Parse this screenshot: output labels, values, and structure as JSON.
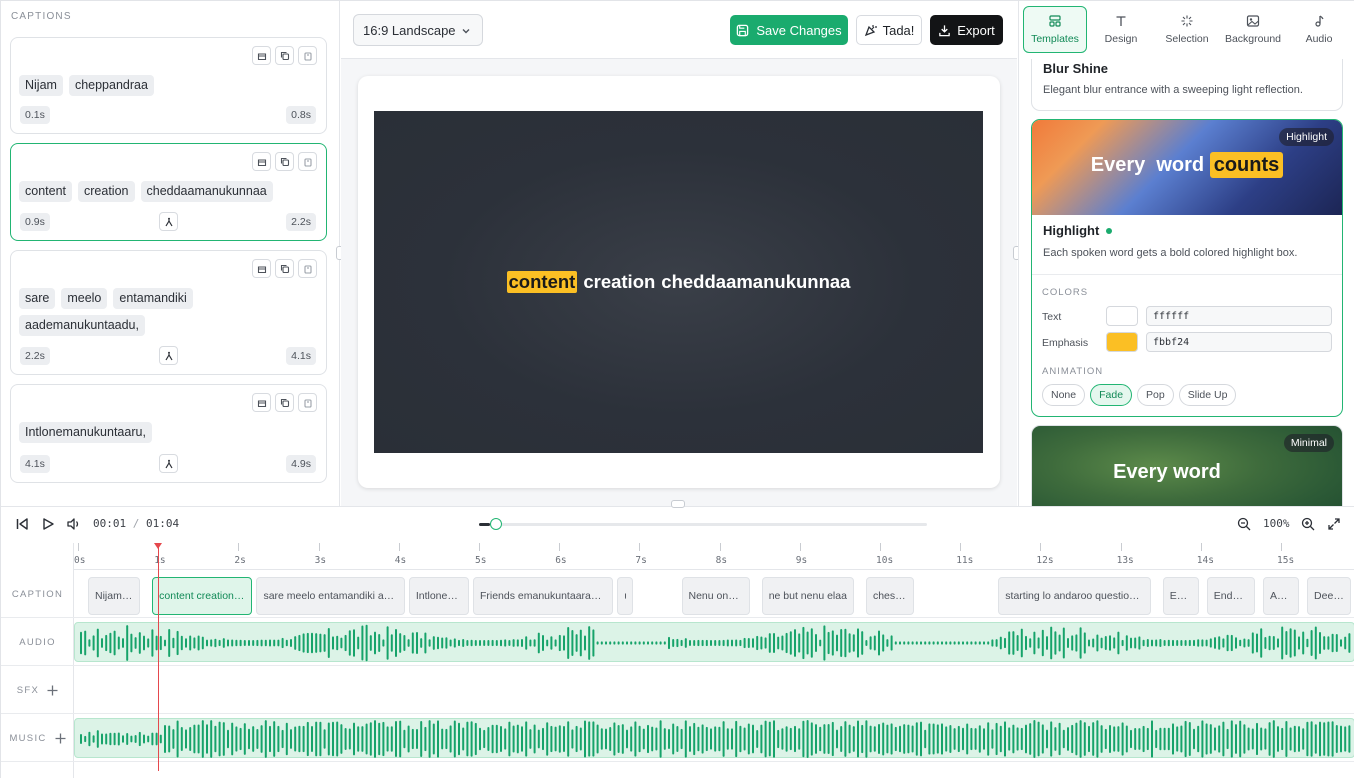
{
  "captions_panel": {
    "title": "CAPTIONS",
    "items": [
      {
        "words": [
          "Nijam",
          "cheppandraa"
        ],
        "start": "0.1s",
        "end": "0.8s",
        "split": false
      },
      {
        "words": [
          "content",
          "creation",
          "cheddaamanukunnaa"
        ],
        "start": "0.9s",
        "end": "2.2s",
        "split": true,
        "active": true
      },
      {
        "words": [
          "sare",
          "meelo",
          "entamandiki",
          "aademanukuntaadu,"
        ],
        "start": "2.2s",
        "end": "4.1s",
        "split": true
      },
      {
        "words": [
          "Intlonemanukuntaaru,"
        ],
        "start": "4.1s",
        "end": "4.9s",
        "split": true
      }
    ]
  },
  "toolbar": {
    "aspect_ratio": "16:9 Landscape",
    "save_label": "Save Changes",
    "tada_label": "Tada!",
    "export_label": "Export"
  },
  "preview": {
    "words": [
      "content",
      "creation",
      "cheddaamanukunnaa"
    ],
    "emphasis_index": 0
  },
  "right_panel": {
    "tabs": [
      {
        "label": "Templates",
        "icon": "templates-icon",
        "active": true
      },
      {
        "label": "Design",
        "icon": "text-icon"
      },
      {
        "label": "Selection",
        "icon": "sparkle-icon"
      },
      {
        "label": "Background",
        "icon": "image-icon"
      },
      {
        "label": "Audio",
        "icon": "music-note-icon"
      }
    ],
    "prev_template": {
      "name": "Blur Shine",
      "desc": "Elegant blur entrance with a sweeping light reflection."
    },
    "selected_template": {
      "tag": "Highlight",
      "thumb_words": [
        "Every",
        "word",
        "counts"
      ],
      "name": "Highlight",
      "desc": "Each spoken word gets a bold colored highlight box.",
      "colors_title": "COLORS",
      "text_label": "Text",
      "text_color": "ffffff",
      "emphasis_label": "Emphasis",
      "emphasis_color": "fbbf24",
      "animation_title": "ANIMATION",
      "animations": [
        "None",
        "Fade",
        "Pop",
        "Slide Up"
      ],
      "active_animation": "Fade"
    },
    "next_template": {
      "tag": "Minimal",
      "thumb_text": "Every word"
    }
  },
  "player": {
    "current_time": "00:01",
    "sep": "/",
    "total_time": "01:04",
    "progress": 0.025,
    "zoom": "100%"
  },
  "timeline": {
    "ticks": [
      "0s",
      "1s",
      "2s",
      "3s",
      "4s",
      "5s",
      "6s",
      "7s",
      "8s",
      "9s",
      "10s",
      "11s",
      "12s",
      "13s",
      "14s",
      "15s"
    ],
    "track_labels": {
      "caption": "CAPTION",
      "audio": "AUDIO",
      "sfx": "SFX",
      "music": "MUSIC"
    },
    "caption_blocks": [
      {
        "text": "Nijam cheppandraa",
        "start": 0.1,
        "end": 0.8
      },
      {
        "text": "content creation cheddaamanukunnaa",
        "start": 0.9,
        "end": 2.2,
        "active": true
      },
      {
        "text": "sare meelo entamandiki aademanukuntaadu,",
        "start": 2.2,
        "end": 4.1
      },
      {
        "text": "Intlonemanukuntaaru,",
        "start": 4.1,
        "end": 4.9
      },
      {
        "text": "Friends emanukuntaarani aalochistunnaaraa?",
        "start": 4.9,
        "end": 6.7
      },
      {
        "text": "u",
        "start": 6.7,
        "end": 6.95
      },
      {
        "text": "Nenu one of them",
        "start": 7.5,
        "end": 8.4
      },
      {
        "text": "ne but nenu elaa",
        "start": 8.5,
        "end": 9.7
      },
      {
        "text": "cheshaanu",
        "start": 9.8,
        "end": 10.45
      },
      {
        "text": "starting lo andaroo questions adigaaru",
        "start": 11.45,
        "end": 13.4
      },
      {
        "text": "Endukante",
        "start": 13.5,
        "end": 14.0
      },
      {
        "text": "Endukante",
        "start": 14.05,
        "end": 14.7
      },
      {
        "text": "Asalu",
        "start": 14.75,
        "end": 15.25
      },
      {
        "text": "Deenivalla",
        "start": 15.3,
        "end": 15.9
      }
    ]
  },
  "colors": {
    "accent": "#1aab6e",
    "playhead": "#e5484d",
    "emphasis": "#fbbf24"
  }
}
